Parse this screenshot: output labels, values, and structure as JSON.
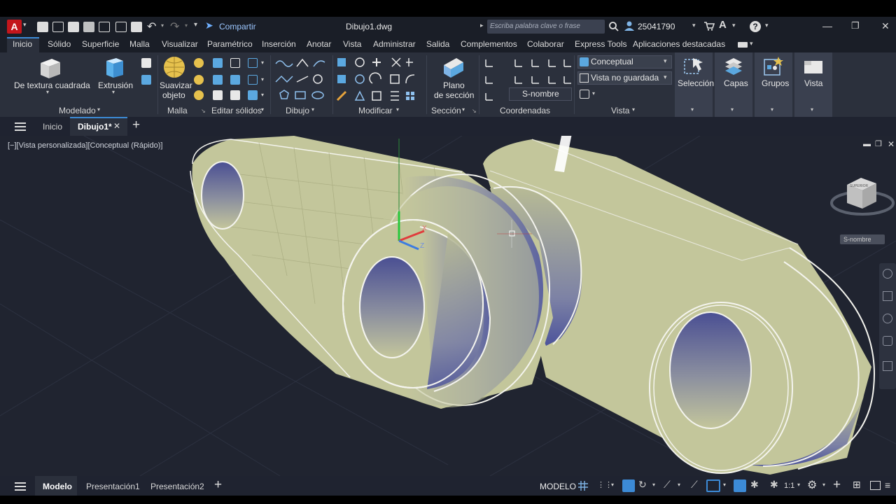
{
  "titlebar": {
    "app_letter": "A",
    "share_label": "Compartir",
    "document_title": "Dibujo1.dwg",
    "search_placeholder": "Escriba palabra clave o frase",
    "user_id": "25041790"
  },
  "ribbon_tabs": [
    "Inicio",
    "Sólido",
    "Superficie",
    "Malla",
    "Visualizar",
    "Paramétrico",
    "Inserción",
    "Anotar",
    "Vista",
    "Administrar",
    "Salida",
    "Complementos",
    "Colaborar",
    "Express Tools",
    "Aplicaciones destacadas"
  ],
  "ribbon": {
    "textured_box_label": "De textura cuadrada",
    "extrusion_label": "Extrusión",
    "smooth_object_label_1": "Suavizar",
    "smooth_object_label_2": "objeto",
    "section_plane_label_1": "Plano",
    "section_plane_label_2": "de sección",
    "visual_style": "Conceptual",
    "view_state": "Vista no guardada",
    "ucs_name": "S-nombre",
    "selection_label": "Selección",
    "layers_label": "Capas",
    "groups_label": "Grupos",
    "view_label": "Vista",
    "panels": {
      "modeling": "Modelado",
      "mesh": "Malla",
      "edit_solids": "Editar sólidos",
      "draw": "Dibujo",
      "modify": "Modificar",
      "section": "Sección",
      "coordinates": "Coordenadas",
      "view": "Vista"
    }
  },
  "file_tabs": {
    "home": "Inicio",
    "current": "Dibujo1*"
  },
  "viewport": {
    "label": "[−][Vista personalizada][Conceptual (Rápido)]",
    "viewcube_name": "S-nombre",
    "viewcube_face": "SUPERIOR"
  },
  "statusbar": {
    "tabs": [
      "Modelo",
      "Presentación1",
      "Presentación2"
    ],
    "mode": "MODELO",
    "scale": "1:1"
  },
  "colors": {
    "accent": "#3c8ad6",
    "solid_face": "#c3c69b",
    "hole_inner": "#525a9c",
    "viewport_bg": "#202430",
    "ribbon_bg": "#2b303c"
  }
}
